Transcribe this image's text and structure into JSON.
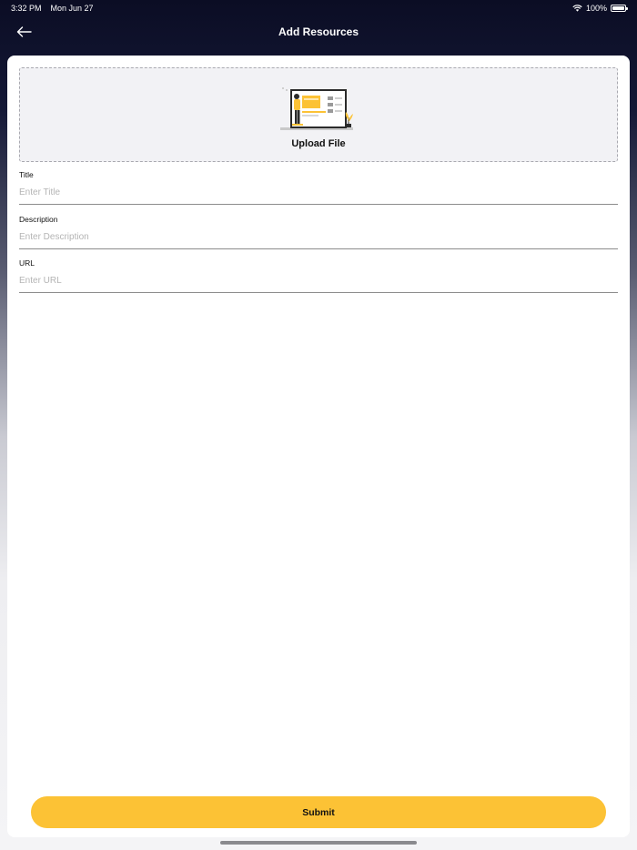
{
  "status_bar": {
    "time": "3:32 PM",
    "date": "Mon Jun 27",
    "battery_percent": "100%",
    "wifi_icon": "wifi-icon",
    "battery_icon": "battery-icon"
  },
  "nav": {
    "title": "Add Resources",
    "back_icon": "arrow-left-icon"
  },
  "upload": {
    "label": "Upload File",
    "illustration": "upload-illustration"
  },
  "form": {
    "title": {
      "label": "Title",
      "placeholder": "Enter Title",
      "value": ""
    },
    "description": {
      "label": "Description",
      "placeholder": "Enter Description",
      "value": ""
    },
    "url": {
      "label": "URL",
      "placeholder": "Enter URL",
      "value": ""
    }
  },
  "submit": {
    "label": "Submit"
  },
  "colors": {
    "accent": "#fcc235",
    "header_bg": "#0b0d24",
    "upload_bg": "#f2f2f5"
  }
}
